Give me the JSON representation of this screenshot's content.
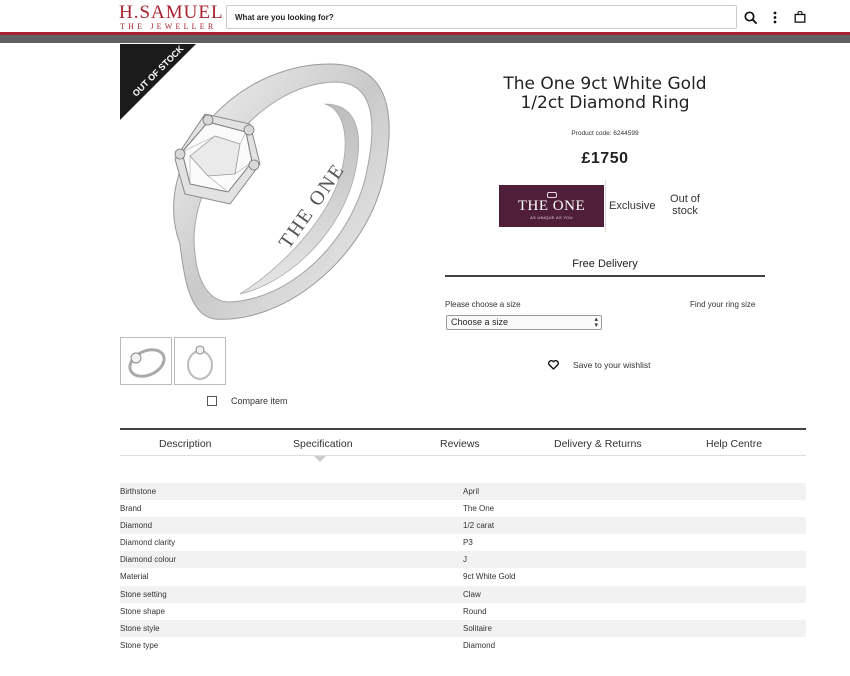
{
  "header": {
    "logo_main": "H.SAMUEL",
    "logo_sub": "THE JEWELLER",
    "search_placeholder": "What are you looking for?",
    "brand_color": "#a8232f",
    "icons": [
      "search-icon",
      "more-vertical-icon",
      "shopping-bag-icon"
    ]
  },
  "product": {
    "badge": "OUT OF STOCK",
    "title_line1": "The One 9ct White Gold",
    "title_line2": "1/2ct Diamond Ring",
    "product_code": "Product code: 6244599",
    "price": "£1750",
    "brand_badge": {
      "name": "THE ONE",
      "tagline": "AS UNIQUE AS YOU",
      "color": "#4f1f3a"
    },
    "exclusive": "Exclusive",
    "stock_line1": "Out of",
    "stock_line2": "stock",
    "free_delivery": "Free Delivery",
    "size_label": "Please choose a size",
    "ring_size_link": "Find your ring size",
    "size_select_value": "Choose a size",
    "wishlist_label": "Save to your wishlist",
    "compare_label": "Compare item",
    "ring_engraving": "THE ONE"
  },
  "tabs": [
    {
      "label": "Description"
    },
    {
      "label": "Specification"
    },
    {
      "label": "Reviews"
    },
    {
      "label": "Delivery & Returns"
    },
    {
      "label": "Help Centre"
    }
  ],
  "specs": [
    {
      "key": "Birthstone",
      "value": "April"
    },
    {
      "key": "Brand",
      "value": "The One"
    },
    {
      "key": "Diamond",
      "value": "1/2 carat"
    },
    {
      "key": "Diamond clarity",
      "value": "P3"
    },
    {
      "key": "Diamond colour",
      "value": "J"
    },
    {
      "key": "Material",
      "value": "9ct White Gold"
    },
    {
      "key": "Stone setting",
      "value": "Claw"
    },
    {
      "key": "Stone shape",
      "value": "Round"
    },
    {
      "key": "Stone style",
      "value": "Solitaire"
    },
    {
      "key": "Stone type",
      "value": "Diamond"
    }
  ]
}
